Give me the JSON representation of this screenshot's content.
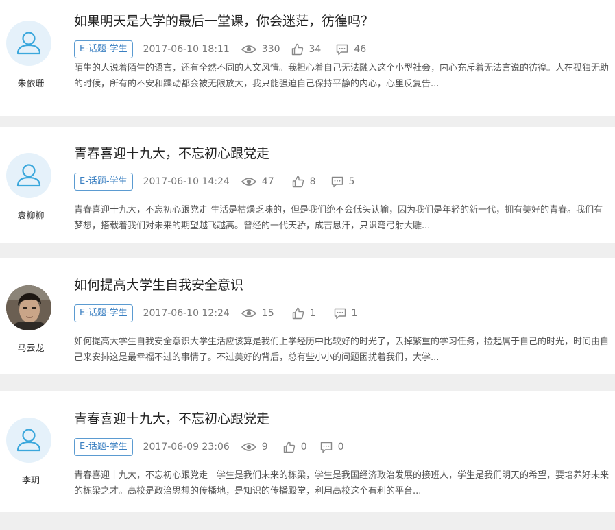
{
  "posts": [
    {
      "author": "朱依珊",
      "avatar": "default-user-icon",
      "title": "如果明天是大学的最后一堂课，你会迷茫，彷徨吗？",
      "tag": "E-话题-学生",
      "date": "2017-06-10 18:11",
      "views": "330",
      "likes": "34",
      "comments": "46",
      "excerpt": "陌生的人说着陌生的语言，还有全然不同的人文风情。我担心着自己无法融入这个小型社会，内心充斥着无法言说的彷徨。人在孤独无助的时候，所有的不安和躁动都会被无限放大，我只能强迫自己保持平静的内心，心里反复告..."
    },
    {
      "author": "袁柳柳",
      "avatar": "default-user-icon",
      "title": "青春喜迎十九大，不忘初心跟党走",
      "tag": "E-话题-学生",
      "date": "2017-06-10 14:24",
      "views": "47",
      "likes": "8",
      "comments": "5",
      "excerpt": " 青春喜迎十九大，不忘初心跟党走 生活是枯燥乏味的，但是我们绝不会低头认输，因为我们是年轻的新一代，拥有美好的青春。我们有梦想，搭载着我们对未来的期望越飞越高。曾经的一代天骄，成吉思汗，只识弯弓射大雕..."
    },
    {
      "author": "马云龙",
      "avatar": "user-photo",
      "title": "如何提高大学生自我安全意识",
      "tag": "E-话题-学生",
      "date": "2017-06-10 12:24",
      "views": "15",
      "likes": "1",
      "comments": "1",
      "excerpt": "如何提高大学生自我安全意识大学生活应该算是我们上学经历中比较好的时光了，丢掉繁重的学习任务，捡起属于自己的时光，时间由自己来安排这是最幸福不过的事情了。不过美好的背后，总有些小小的问题困扰着我们，大学..."
    },
    {
      "author": "李玥",
      "avatar": "default-user-icon",
      "title": "青春喜迎十九大，不忘初心跟党走",
      "tag": "E-话题-学生",
      "date": "2017-06-09 23:06",
      "views": "9",
      "likes": "0",
      "comments": "0",
      "excerpt": "青春喜迎十九大，不忘初心跟党走　学生是我们未来的栋梁，学生是我国经济政治发展的接班人，学生是我们明天的希望，要培养好未来的栋梁之才。高校是政治思想的传播地，是知识的传播殿堂，利用高校这个有利的平台..."
    }
  ],
  "colors": {
    "tag_border": "#5b9bd1",
    "tag_text": "#3a7fc1",
    "avatar_bg": "#e5f1fa",
    "avatar_icon": "#3aa7dc",
    "page_bg": "#efefef"
  }
}
